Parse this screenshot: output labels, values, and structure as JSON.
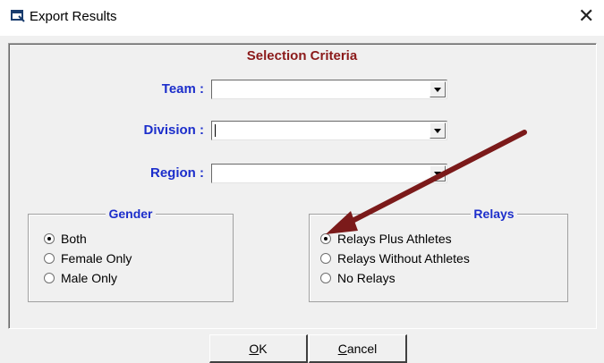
{
  "window": {
    "title": "Export Results",
    "close_glyph": "✕",
    "icon": "window-app-icon"
  },
  "selection_criteria": {
    "title": "Selection Criteria"
  },
  "fields": {
    "team": {
      "label": "Team :",
      "value": ""
    },
    "division": {
      "label": "Division :",
      "value": ""
    },
    "region": {
      "label": "Region :",
      "value": ""
    }
  },
  "gender": {
    "title": "Gender",
    "options": [
      {
        "label": "Both",
        "selected": true
      },
      {
        "label": "Female Only",
        "selected": false
      },
      {
        "label": "Male Only",
        "selected": false
      }
    ]
  },
  "relays": {
    "title": "Relays",
    "options": [
      {
        "label": "Relays Plus Athletes",
        "selected": true
      },
      {
        "label": "Relays Without Athletes",
        "selected": false
      },
      {
        "label": "No Relays",
        "selected": false
      }
    ]
  },
  "buttons": {
    "ok": {
      "mnemonic": "O",
      "rest": "K"
    },
    "cancel": {
      "mnemonic": "C",
      "rest": "ancel"
    }
  },
  "annotation": {
    "color": "#7b1a1a",
    "type": "arrow"
  },
  "colors": {
    "label_blue": "#1c2ecb",
    "title_maroon": "#8b1a1a",
    "dialog_bg": "#f0f0f0"
  }
}
